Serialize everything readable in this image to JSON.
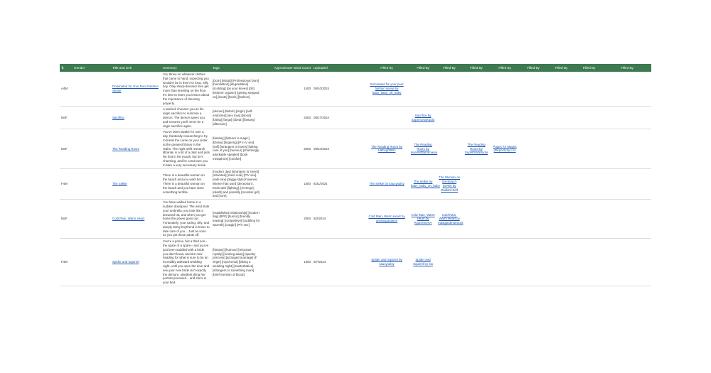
{
  "headers": [
    "Gender",
    "Title and Link",
    "Summary",
    "Tags",
    "Approximate Word Count",
    "Uploaded",
    "Filled By",
    "Filled By",
    "Filled By",
    "Filled By",
    "Filled By",
    "Filled By",
    "Filled By",
    "Filled By",
    "Filled By"
  ],
  "header_sort_icon": "sort-icon",
  "colors": {
    "header_bg": "#3d7a4f",
    "header_text": "#ffffff",
    "link": "#1a55b0"
  },
  "rows": [
    {
      "gender": "A4M",
      "title": "Dominated for Your Poor Fashion Sense",
      "summary": "You threw on whatever clothes that came to hand, expecting you wouldn't be in them for long. Silly boy. Only sharp-dressed men get more than kneeling on the floor. It's time to learn you lesson about the importance of dressing properly.",
      "tags": "[Dom] [MSub] [Professional Dom] [humiliation] [degradation] [scolding] [on your knees] [clit] [tisherer orgasm] [getting stepped on] [boots] [heels] [fashion]",
      "words": "1400",
      "uploaded": "08/10/2024",
      "fills": [
        "Dominated for your poor fashion sense by baby_baby_oh_baby",
        "",
        "",
        "",
        "",
        "",
        "",
        "",
        ""
      ]
    },
    {
      "gender": "M4F",
      "title": "Sacrifice",
      "summary": "A warlock chooses you as his virgin sacrifice to summon a demon. The demon saves you and ensures you'll never be a virgin sacrifice again.",
      "tags": "[demon] [Mdom] [virgin] [self-endorsed] [sex toys] [blood] [biting] [fangs] [cbeat] [fantasy] [aftercare]",
      "words": "2500",
      "uploaded": "08/17/2024",
      "fills": [
        "",
        "Sacrifice by SupernovaAudio",
        "",
        "",
        "",
        "",
        "",
        "",
        ""
      ]
    },
    {
      "gender": "M4F",
      "title": "The Reading Room",
      "summary": "You've been awake for over a day, frantically researching to try to break the curse on your sister at the greatest library in the realm. The night shift research librarian is a bit of a dork and puts his foot in his mouth, but he's charming, and he convinces you to take a very necessary break.",
      "tags": "[fantasy] [listener is magic] [library] [fingering] [P in V sex] [soft] [strangers to lovers] [taking care of you] [humour] [charmingly adorkable speaker] [book metaphors] [comfort]",
      "words": "2000",
      "uploaded": "08/24/2024",
      "fills": [
        "The Reading Room by HalfLight501",
        "The Reading Room by HarvestSynomania",
        "",
        "The Reading Room by SupernovaAudio",
        "Pages for Mages (Repost) by Lux",
        "",
        "",
        "",
        ""
      ]
    },
    {
      "gender": "F4M",
      "title": "The Selkie",
      "summary": "There is a beautiful woman on the beach and you want her. There is a beautiful woman on the beach and you have done something terrible.",
      "tags": "[modern day] [strangers to lovers] [stranded] [meet cute] [P/V sex] [safe sex] [doggy-style] however, listener has used [deception] . Ends with [fighting], [revenge], [death] and possibly [monster girl] and [vore].",
      "words": "1500",
      "uploaded": "8/31/2024",
      "fills": [
        "The Selkie by saucysalsy",
        "The Selkie by baby_baby_oh_baby",
        "The Woman on the Beach (SPW) by Radiant Self",
        "",
        "",
        "",
        "",
        "",
        ""
      ]
    },
    {
      "gender": "M4F",
      "title": "Cold Rain, Warm Heart",
      "summary": "You have walked home in a sudden downpour. The wind stole your umbrella, you look like a drowned rat, and when you get home the power goes out. Fortunately, your caring, silly, and deeply dorky boyfriend is home to take care of you... Just as soon as you get those pants off.",
      "tags": "[established relationship] [modern day] [BFE] [humor] [friendly teasing] [competitive] [cuddling for warmth] [cowgirl] [P/V sex]",
      "words": "2000",
      "uploaded": "9/2/2024",
      "fills": [
        "Cold Rain, Warm Heart by gruesquasaints",
        "Cold Rain, Warm Heart by RyanTreeVA",
        "Cold Rain, Warm Heart by masquedmurmurs",
        "",
        "",
        "",
        "",
        "",
        ""
      ]
    },
    {
      "gender": "F4M",
      "title": "Spider and Squirrel",
      "summary": "You're a prince, but a third son-- the spare of a spare-- and you've just been saddled with a bride you don't know, and are now heading for what is sure to be an incredibly awkward wedding night, until you open the door and see your new bride isn't exactly the demure, obedient thing her portrait promised... and she's in your bed.",
      "tags": "[fantasy] [humour] [reluctant royalty] [running away] [spunky princess] [arranged marriage] [F virgin] [royal smut] [faking a wedding night] [masturbation] [strangers to something more] [brief mention of blood]",
      "words": "1500",
      "uploaded": "9/7/2024",
      "fills": [
        "Spider and Squirrel by saucysalsy",
        "Spider and Squirrel by 6ix",
        "",
        "",
        "",
        "",
        "",
        "",
        ""
      ]
    }
  ]
}
